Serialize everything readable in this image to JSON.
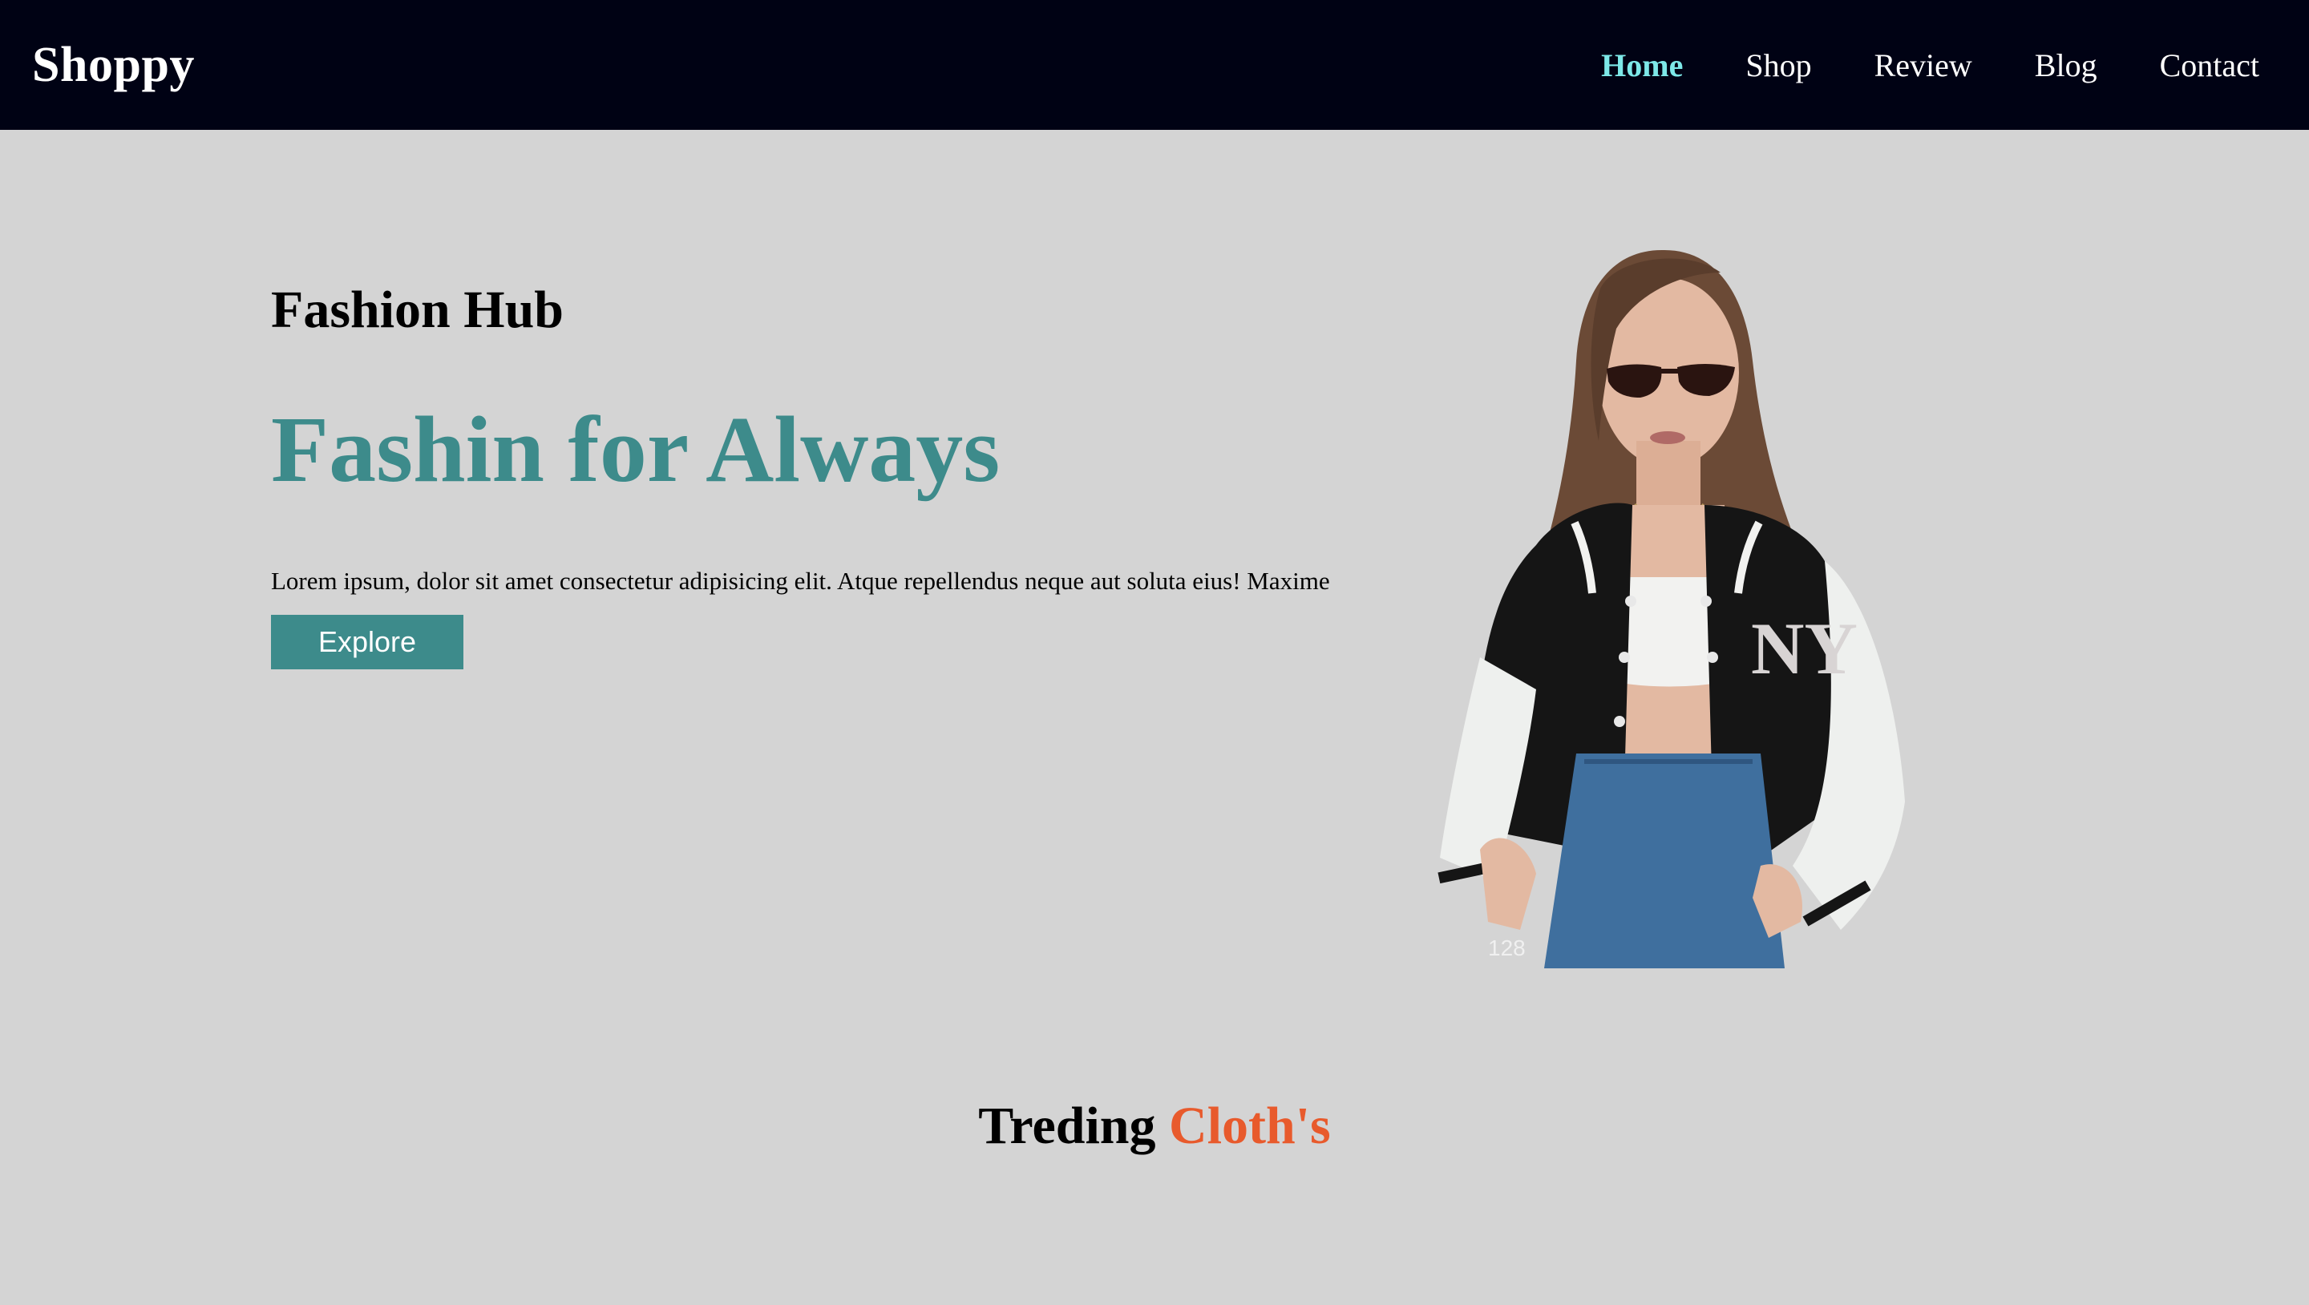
{
  "nav": {
    "brand": "Shoppy",
    "links": [
      {
        "label": "Home",
        "active": true
      },
      {
        "label": "Shop",
        "active": false
      },
      {
        "label": "Review",
        "active": false
      },
      {
        "label": "Blog",
        "active": false
      },
      {
        "label": "Contact",
        "active": false
      }
    ]
  },
  "hero": {
    "eyebrow": "Fashion Hub",
    "headline": "Fashin for Always",
    "description": "Lorem ipsum, dolor sit amet consectetur adipisicing elit. Atque repellendus neque aut soluta eius! Maxime",
    "cta_label": "Explore",
    "image_caption": "128"
  },
  "trending": {
    "title_part1": "Treding",
    "title_part2": "Cloth's"
  },
  "colors": {
    "nav_bg": "#000214",
    "page_bg": "#d4d4d4",
    "accent_teal": "#3d8b8b",
    "active_link": "#7de8e8",
    "accent_orange": "#e85a2c"
  }
}
